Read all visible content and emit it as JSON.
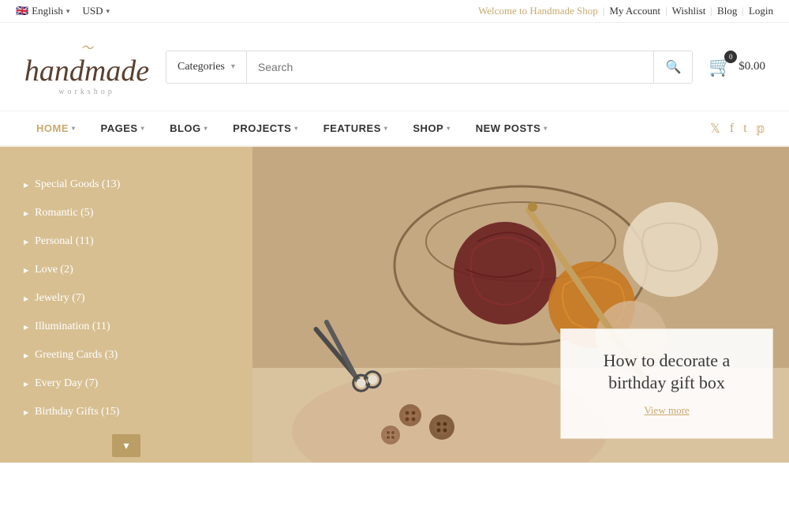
{
  "topbar": {
    "language": "English",
    "currency": "USD",
    "welcome": "Welcome to Handmade Shop",
    "links": [
      "My Account",
      "Wishlist",
      "Blog",
      "Login"
    ]
  },
  "logo": {
    "brand": "handmade",
    "swirl": "〜",
    "tagline": "workshop"
  },
  "search": {
    "categories_label": "Categories",
    "placeholder": "Search",
    "button_label": "🔍"
  },
  "cart": {
    "count": "0",
    "total": "$0.00"
  },
  "nav": {
    "items": [
      {
        "label": "HOME",
        "active": true,
        "has_arrow": true
      },
      {
        "label": "PAGES",
        "active": false,
        "has_arrow": true
      },
      {
        "label": "BLOG",
        "active": false,
        "has_arrow": true
      },
      {
        "label": "PROJECTS",
        "active": false,
        "has_arrow": true
      },
      {
        "label": "FEATURES",
        "active": false,
        "has_arrow": true
      },
      {
        "label": "SHOP",
        "active": false,
        "has_arrow": true
      },
      {
        "label": "NEW POSTS",
        "active": false,
        "has_arrow": true
      }
    ],
    "social": [
      "twitter",
      "facebook",
      "tumblr",
      "pinterest"
    ]
  },
  "sidebar": {
    "items": [
      {
        "label": "Special Goods (13)"
      },
      {
        "label": "Romantic (5)"
      },
      {
        "label": "Personal (11)"
      },
      {
        "label": "Love (2)"
      },
      {
        "label": "Jewelry (7)"
      },
      {
        "label": "Illumination (11)"
      },
      {
        "label": "Greeting Cards (3)"
      },
      {
        "label": "Every Day (7)"
      },
      {
        "label": "Birthday Gifts (15)"
      }
    ],
    "more_btn": "▾"
  },
  "hero": {
    "caption_title": "How to decorate a birthday gift box",
    "caption_link": "View more"
  }
}
